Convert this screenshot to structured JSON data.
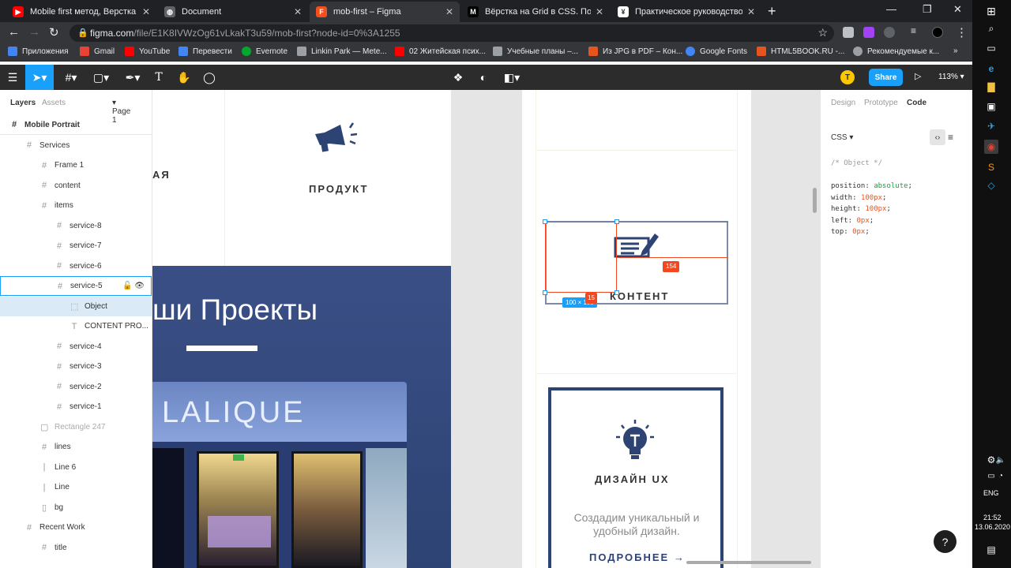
{
  "browser": {
    "tabs": [
      {
        "title": "Mobile first метод, Верстка сайта",
        "fav_color": "#ff0000",
        "fav_glyph": "▶"
      },
      {
        "title": "Document",
        "fav_color": "#5f6368",
        "fav_glyph": "◍"
      },
      {
        "title": "mob-first – Figma",
        "fav_color": "#f24e1e",
        "fav_glyph": "F"
      },
      {
        "title": "Вёрстка на Grid в CSS. Полное руков",
        "fav_color": "#000000",
        "fav_glyph": "M"
      },
      {
        "title": "Практическое руководство по...",
        "fav_color": "#ffffff",
        "fav_glyph": "¥"
      }
    ],
    "url_host": "figma.com",
    "url_path": "/file/E1K8IVWzOg61vLkakT3u59/mob-first?node-id=0%3A1255",
    "bookmarks": [
      {
        "label": "Приложения",
        "color": "#4285f4"
      },
      {
        "label": "Gmail",
        "color": "#ea4335"
      },
      {
        "label": "YouTube",
        "color": "#ff0000"
      },
      {
        "label": "Перевести",
        "color": "#4285f4"
      },
      {
        "label": "Evernote",
        "color": "#00a82d"
      },
      {
        "label": "Linkin Park — Mete...",
        "color": "#9aa0a6"
      },
      {
        "label": "02 Житейская псих...",
        "color": "#ff0000"
      },
      {
        "label": "Учебные планы –...",
        "color": "#9aa0a6"
      },
      {
        "label": "Из JPG в PDF – Кон...",
        "color": "#e8541f"
      },
      {
        "label": "Google Fonts",
        "color": "#4285f4"
      },
      {
        "label": "HTML5BOOK.RU -...",
        "color": "#e8541f"
      },
      {
        "label": "Рекомендуемые к...",
        "color": "#9aa0a6"
      }
    ]
  },
  "figma": {
    "share_label": "Share",
    "zoom": "113%",
    "avatar_letter": "T",
    "layers_tab": "Layers",
    "assets_tab": "Assets",
    "page_label": "Page 1",
    "layers": [
      {
        "name": "Mobile Portrait",
        "level": 0,
        "icon": "#"
      },
      {
        "name": "Services",
        "level": 1,
        "icon": "#"
      },
      {
        "name": "Frame 1",
        "level": 2,
        "icon": "#"
      },
      {
        "name": "content",
        "level": 2,
        "icon": "#"
      },
      {
        "name": "items",
        "level": 2,
        "icon": "#"
      },
      {
        "name": "service-8",
        "level": 3,
        "icon": "#"
      },
      {
        "name": "service-7",
        "level": 3,
        "icon": "#"
      },
      {
        "name": "service-6",
        "level": 3,
        "icon": "#"
      },
      {
        "name": "service-5",
        "level": 3,
        "icon": "#"
      },
      {
        "name": "Object",
        "level": 4,
        "icon": "⬚"
      },
      {
        "name": "CONTENT PRO...",
        "level": 4,
        "icon": "T"
      },
      {
        "name": "service-4",
        "level": 3,
        "icon": "#"
      },
      {
        "name": "service-3",
        "level": 3,
        "icon": "#"
      },
      {
        "name": "service-2",
        "level": 3,
        "icon": "#"
      },
      {
        "name": "service-1",
        "level": 3,
        "icon": "#"
      },
      {
        "name": "Rectangle 247",
        "level": 2,
        "icon": "▢"
      },
      {
        "name": "lines",
        "level": 2,
        "icon": "#"
      },
      {
        "name": "Line 6",
        "level": 2,
        "icon": "|"
      },
      {
        "name": "Line",
        "level": 2,
        "icon": "|"
      },
      {
        "name": "bg",
        "level": 2,
        "icon": "▯"
      },
      {
        "name": "Recent Work",
        "level": 1,
        "icon": "#"
      },
      {
        "name": "title",
        "level": 2,
        "icon": "#"
      }
    ],
    "right_tabs": {
      "design": "Design",
      "prototype": "Prototype",
      "code": "Code"
    },
    "css_label": "CSS",
    "code_lines": [
      {
        "text": "/* Object */",
        "kind": "comment"
      },
      {
        "text": "",
        "kind": "blank"
      },
      {
        "text": "position: ",
        "value": "absolute",
        "kind": "kw"
      },
      {
        "text": "width: ",
        "value": "100px",
        "kind": "num"
      },
      {
        "text": "height: ",
        "value": "100px",
        "kind": "num"
      },
      {
        "text": "left: ",
        "value": "0px",
        "kind": "num"
      },
      {
        "text": "top: ",
        "value": "0px",
        "kind": "num"
      }
    ]
  },
  "canvas": {
    "service_left_partial": "АЯ",
    "service_product": "ПРОДУКТ",
    "projects_title": "ши Проекты",
    "lalique": "LALIQUE",
    "content_label": "КОНТЕНТ",
    "size_badge": "100 × 100",
    "gap_badge_v": "15",
    "gap_badge_h": "154",
    "design_title": "ДИЗАЙН UX",
    "design_desc_1": "Создадим уникальный и",
    "design_desc_2": "удобный дизайн.",
    "more_link": "ПОДРОБНЕЕ →",
    "brand_navy": "#2d4373",
    "measure_red": "#f24822",
    "select_blue": "#18a0fb"
  },
  "taskbar": {
    "lang": "ENG",
    "time": "21:52",
    "date": "13.06.2020"
  }
}
